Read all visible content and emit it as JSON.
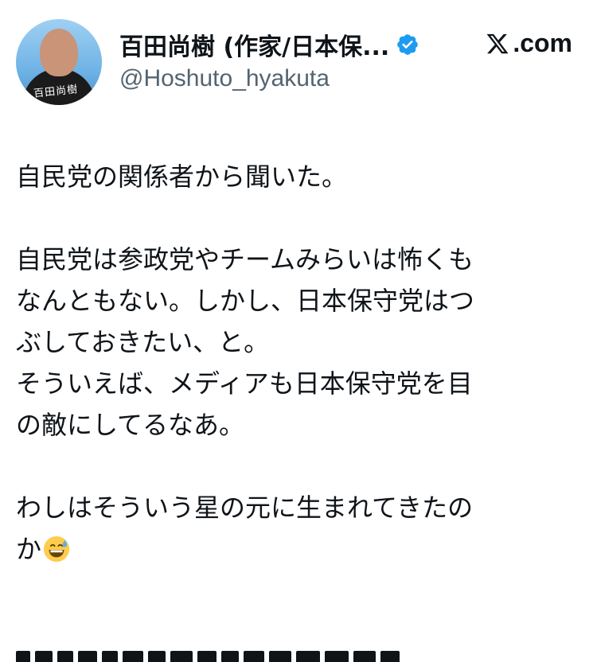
{
  "post": {
    "author": {
      "display_name": "百田尚樹 (作家/日本保...",
      "handle": "@Hoshuto_hyakuta",
      "avatar_signature": "百田尚樹",
      "verified": true
    },
    "brand": {
      "label": ".com",
      "icon": "x-logo-icon"
    },
    "text_lines": [
      "自民党の関係者から聞いた。",
      "",
      "自民党は参政党やチームみらいは怖くも",
      "なんともない。しかし、日本保守党はつ",
      "ぶしておきたい、と。",
      "そういえば、メディアも日本保守党を目",
      "の敵にしてるなあ。",
      "",
      "わしはそういう星の元に生まれてきたの",
      "か"
    ],
    "emoji": "grinning-face-with-sweat-icon"
  },
  "colors": {
    "text": "#0f1419",
    "secondary": "#536471",
    "verified_blue": "#1d9bf0",
    "background": "#ffffff"
  }
}
